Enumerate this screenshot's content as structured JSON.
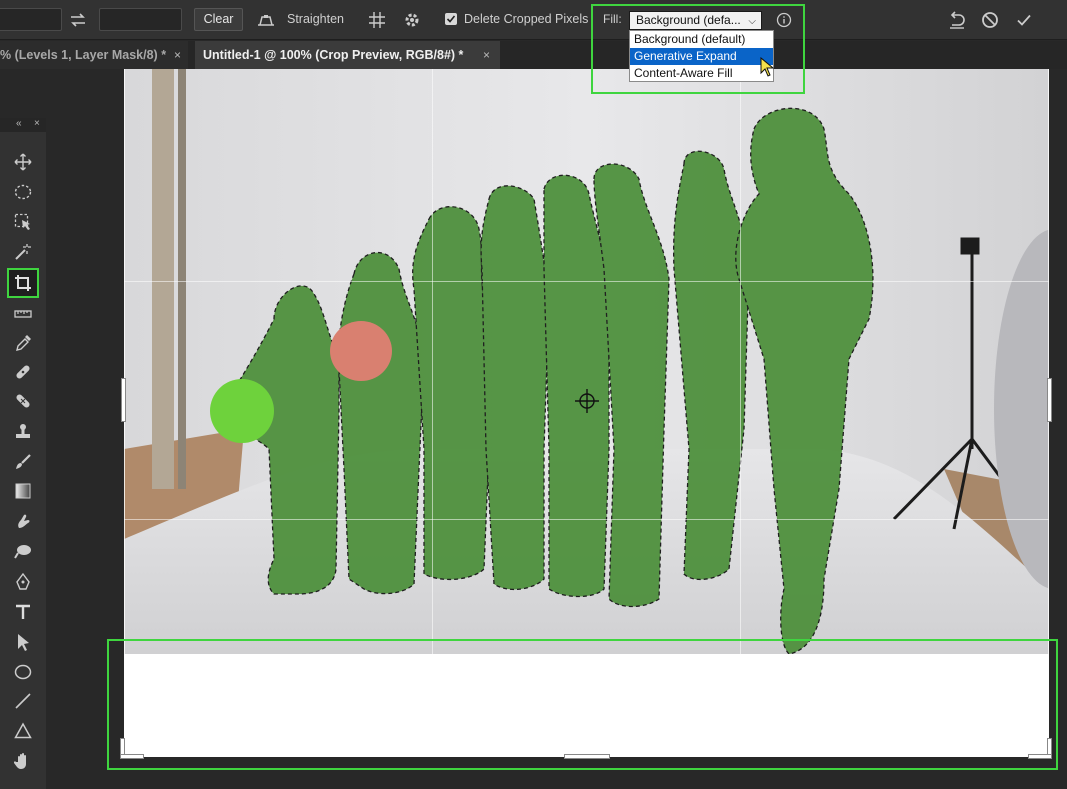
{
  "options_bar": {
    "clear_label": "Clear",
    "straighten_label": "Straighten",
    "delete_cropped_label": "Delete Cropped Pixels",
    "delete_cropped_checked": true,
    "fill_label": "Fill:",
    "fill_value": "Background (defa...",
    "fill_options": [
      "Background (default)",
      "Generative Expand",
      "Content-Aware Fill"
    ],
    "fill_selected_index": 1
  },
  "tabs": [
    {
      "label": "% (Levels 1, Layer Mask/8) *",
      "active": false
    },
    {
      "label": "Untitled-1 @ 100% (Crop Preview, RGB/8#) *",
      "active": true
    }
  ],
  "toolbar": {
    "tools": [
      "move-tool",
      "marquee-tool",
      "object-selection-tool",
      "magic-wand-tool",
      "crop-tool",
      "ruler-tool",
      "eyedropper-tool",
      "healing-brush-tool",
      "patch-tool",
      "clone-stamp-tool",
      "brush-tool",
      "gradient-tool",
      "smudge-tool",
      "dodge-tool",
      "pen-tool",
      "type-tool",
      "path-selection-tool",
      "ellipse-tool",
      "line-tool",
      "triangle-tool",
      "hand-tool"
    ],
    "active_tool": "crop-tool"
  },
  "colors": {
    "highlight": "#3fd53f",
    "selection_overlay": "#4e9a3c",
    "dropdown_selected": "#0a64c8"
  }
}
